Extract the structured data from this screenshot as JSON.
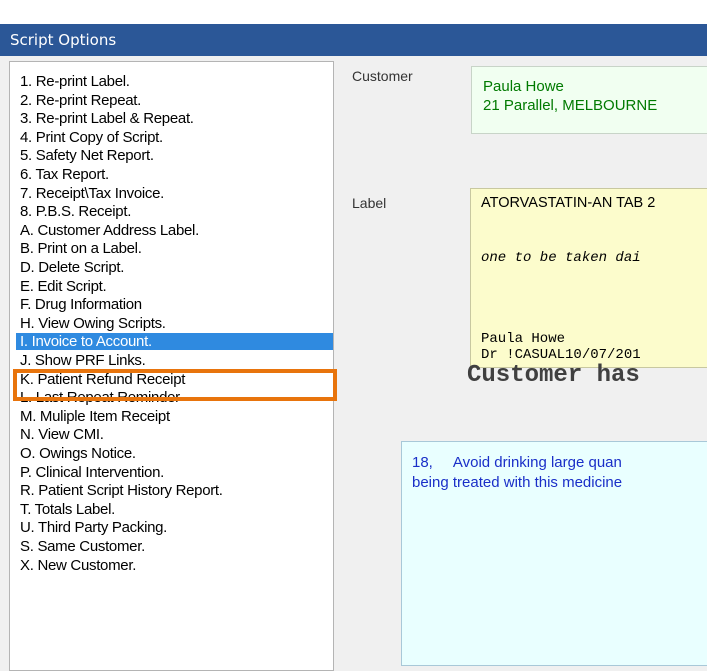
{
  "window": {
    "title": "Script Options"
  },
  "menu": {
    "items": [
      "1. Re-print Label.",
      "2. Re-print Repeat.",
      "3. Re-print Label & Repeat.",
      "4. Print Copy of Script.",
      "5. Safety Net Report.",
      "6. Tax Report.",
      "7. Receipt\\Tax Invoice.",
      "8. P.B.S. Receipt.",
      "A. Customer Address Label.",
      "B. Print on a Label.",
      "D. Delete Script.",
      "E. Edit Script.",
      "F. Drug Information",
      "H. View Owing Scripts.",
      "I. Invoice to Account.",
      "J. Show PRF Links.",
      "K. Patient Refund Receipt",
      "L. Last Repeat Reminder",
      "M. Muliple Item Receipt",
      "N. View CMI.",
      "O. Owings Notice.",
      "P. Clinical Intervention.",
      "R. Patient Script History Report.",
      "T. Totals Label.",
      "U. Third Party Packing.",
      "S. Same Customer.",
      "X. New Customer."
    ],
    "selected_index": 14
  },
  "customer": {
    "label": "Customer",
    "name": "Paula Howe",
    "address": "21 Parallel, MELBOURNE"
  },
  "label_section": {
    "label": "Label",
    "drug": "ATORVASTATIN-AN TAB 2",
    "directions": "one to be taken dai",
    "patient": "Paula Howe",
    "doctor": "Dr !CASUAL10/07/201"
  },
  "notice": "Customer has",
  "warning": {
    "line1": "18,     Avoid drinking large quan",
    "line2": "being treated with this medicine"
  },
  "colors": {
    "titlebar": "#2b5797",
    "selection": "#2f8ae0",
    "callout": "#e8740c",
    "customer_text": "#007a00",
    "warning_text": "#1a2fc8"
  }
}
